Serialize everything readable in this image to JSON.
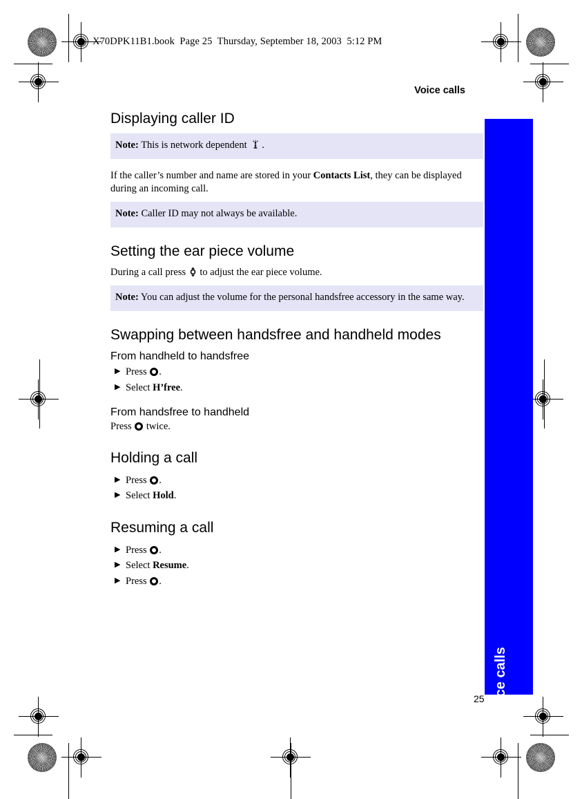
{
  "print": {
    "file_stamp": "X70DPK11B1.book  Page 25  Thursday, September 18, 2003  5:12 PM"
  },
  "page": {
    "running_head": "Voice calls",
    "folio": "25",
    "thumb_tab_label": "Voice calls",
    "thumb_tab_color": "#0000FF",
    "note_background": "#E4E4F6"
  },
  "sections": [
    {
      "heading": "Displaying caller ID",
      "note1_label": "Note:",
      "note1_text": "This is network dependent",
      "note1_icon": "network-signal-icon",
      "note1_tail": ".",
      "body_pre": "If the caller’s number and name are stored in your ",
      "body_bold": "Contacts List",
      "body_post": ", they can be displayed during an incoming call.",
      "note2_label": "Note:",
      "note2_text": "Caller ID may not always be available."
    },
    {
      "heading": "Setting the ear piece volume",
      "body_pre": "During a call press ",
      "body_icon": "up-down-key-icon",
      "body_post": " to adjust the ear piece volume.",
      "note_label": "Note:",
      "note_text": "You can adjust the volume for the personal handsfree accessory in the same way."
    },
    {
      "heading": "Swapping between handsfree and handheld modes",
      "sub1": "From handheld to handsfree",
      "sub1_steps": [
        {
          "pre": "Press ",
          "icon": "select-key-icon",
          "post": "."
        },
        {
          "pre": "Select ",
          "bold": "H’free",
          "post": "."
        }
      ],
      "sub2": "From handsfree to handheld",
      "sub2_body_pre": "Press ",
      "sub2_body_icon": "select-key-icon",
      "sub2_body_post": " twice."
    },
    {
      "heading": "Holding a call",
      "steps": [
        {
          "pre": "Press ",
          "icon": "select-key-icon",
          "post": "."
        },
        {
          "pre": "Select ",
          "bold": "Hold",
          "post": "."
        }
      ]
    },
    {
      "heading": "Resuming a call",
      "steps": [
        {
          "pre": "Press ",
          "icon": "select-key-icon",
          "post": "."
        },
        {
          "pre": "Select ",
          "bold": "Resume",
          "post": "."
        },
        {
          "pre": "Press ",
          "icon": "select-key-icon",
          "post": "."
        }
      ]
    }
  ],
  "bullet_glyph": "▶"
}
